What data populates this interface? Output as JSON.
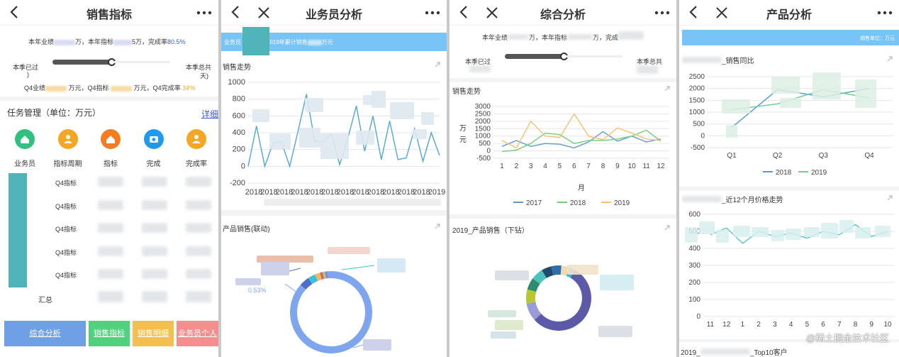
{
  "panels": {
    "p1": {
      "title": "销售指标",
      "year_line": {
        "a": "本年业绩",
        "b": "万，本年指标",
        "c": "5万，完成率",
        "rate": "80.5%"
      },
      "season_left": "本季已过",
      "season_right": "本季总共",
      "season_right2": "天)",
      "q4_line": {
        "a": "Q4业绩",
        "b": "万元，Q4指标",
        "c": "万元，Q4完成率",
        "rate": "34%"
      },
      "task_title": "任务管理（单位：万元）",
      "detail_link": "详细",
      "icons": [
        {
          "label": "业务员",
          "color": "#2ec27e",
          "icon": "home-icon"
        },
        {
          "label": "指标周期",
          "color": "#f5a623",
          "icon": "person-icon"
        },
        {
          "label": "指标",
          "color": "#f57c1f",
          "icon": "home-icon"
        },
        {
          "label": "完成",
          "color": "#1e9bf0",
          "icon": "camera-icon"
        },
        {
          "label": "完成率",
          "color": "#f5a623",
          "icon": "person-icon"
        }
      ],
      "rows": [
        "Q4指标",
        "Q4指标",
        "Q4指标",
        "Q4指标",
        "Q4指标"
      ],
      "total_label": "汇总",
      "tabs": [
        {
          "label": "综合分析",
          "color": "#6fa0e6"
        },
        {
          "label": "销售指标",
          "color": "#4fd17e"
        },
        {
          "label": "销售明细",
          "color": "#f5bf4f"
        },
        {
          "label": "业务员个人",
          "color": "#f58f8f"
        }
      ]
    },
    "p2": {
      "title": "业务员分析",
      "banner": {
        "a": "业务员",
        "b": "2019年累计销售",
        "c": "万元"
      },
      "trend_title": "销售走势",
      "pie_title": "产品销售(联动)",
      "pie_label": "0.53%"
    },
    "p3": {
      "title": "综合分析",
      "year_line": {
        "a": "本年业绩",
        "b": "万，本年指标",
        "c": "万，完成"
      },
      "season_left": "本季已过",
      "season_right": "本季总共",
      "trend_title": "销售走势",
      "donut_title": "2019_产品销售（下钻）"
    },
    "p4": {
      "title": "产品分析",
      "banner": "销售单位：万元",
      "compare_title": "_销售同比",
      "price_title": "_近12个月价格走势",
      "top_title": "2019_",
      "top_title_end": "_Top10客户"
    }
  },
  "watermark": "@稀土掘金技术社区",
  "chart_data": [
    {
      "type": "line",
      "title": "销售走势",
      "ylim": [
        -200,
        1000
      ],
      "yticks": [
        -200,
        0,
        200,
        400,
        600,
        800,
        1000
      ],
      "x": [
        "2018",
        "2018",
        "2018",
        "2018",
        "2018",
        "2018",
        "2018",
        "2018",
        "2018",
        "2018",
        "2018",
        "2018",
        "2019"
      ],
      "series": [
        {
          "values": [
            0,
            480,
            0,
            280,
            290,
            0,
            420,
            860,
            300,
            290,
            380,
            20,
            340,
            720,
            180,
            600,
            80,
            540,
            80,
            100,
            450,
            60,
            400,
            130
          ],
          "color": "#5aa9d6"
        }
      ]
    },
    {
      "type": "line",
      "title": "销售走势",
      "xlabel": "月",
      "ylabel": "万元",
      "ylim": [
        -500,
        3000
      ],
      "yticks": [
        -500,
        0,
        500,
        1000,
        1500,
        2000,
        2500,
        3000
      ],
      "categories": [
        "1",
        "2",
        "3",
        "4",
        "5",
        "6",
        "7",
        "8",
        "9",
        "10",
        "11",
        "12"
      ],
      "series": [
        {
          "name": "2017",
          "color": "#5b9bd5",
          "values": [
            300,
            700,
            300,
            500,
            450,
            200,
            600,
            1300,
            650,
            1000,
            600,
            800
          ]
        },
        {
          "name": "2018",
          "color": "#70ce7a",
          "values": [
            -50,
            50,
            500,
            1200,
            1100,
            500,
            700,
            700,
            800,
            1000,
            1400,
            650
          ]
        },
        {
          "name": "2019",
          "color": "#f5c06b",
          "values": [
            700,
            200,
            2000,
            1000,
            900,
            2500,
            1000,
            750,
            1550,
            1200,
            800,
            700
          ]
        }
      ]
    },
    {
      "type": "line",
      "title": "_销售同比",
      "ylim": [
        -500,
        2500
      ],
      "yticks": [
        -500,
        0,
        500,
        1000,
        1500,
        2000,
        2500
      ],
      "categories": [
        "Q1",
        "Q2",
        "Q3",
        "Q4"
      ],
      "series": [
        {
          "name": "2018",
          "color": "#5b9bd5",
          "values": [
            350,
            1950,
            1650,
            2000
          ]
        },
        {
          "name": "2019",
          "color": "#70ce9a",
          "values": [
            1100,
            1350,
            1950,
            1600
          ]
        }
      ]
    },
    {
      "type": "line",
      "title": "_近12个月价格走势",
      "ylim": [
        0,
        600
      ],
      "yticks": [
        0,
        100,
        200,
        300,
        400,
        500,
        600
      ],
      "categories": [
        "11",
        "12",
        "1",
        "2",
        "3",
        "4",
        "5",
        "6",
        "7",
        "8",
        "9",
        "10"
      ],
      "series": [
        {
          "color": "#5ac4d0",
          "values": [
            480,
            520,
            430,
            500,
            470,
            490,
            460,
            500,
            480,
            540,
            470,
            500
          ]
        }
      ]
    },
    {
      "type": "pie",
      "title": "产品销售(联动)",
      "labels": [
        "0.53%"
      ],
      "series": [
        {
          "values": [
            88,
            4,
            3,
            2,
            1,
            1,
            1
          ],
          "colors": [
            "#7ea6ef",
            "#4d6fc9",
            "#38c1d8",
            "#f2b766",
            "#e25b5b",
            "#90d47f",
            "#9b7fd6"
          ]
        }
      ]
    },
    {
      "type": "pie",
      "title": "2019_产品销售（下钻）",
      "series": [
        {
          "values": [
            55,
            9,
            7,
            6,
            6,
            5,
            5,
            4,
            3
          ],
          "colors": [
            "#5b59a8",
            "#9a9ad8",
            "#b8c632",
            "#2b8c6e",
            "#4cc2bd",
            "#1f4a6e",
            "#2f6ea8",
            "#f0d9b5",
            "#38b4e0"
          ]
        }
      ]
    }
  ]
}
